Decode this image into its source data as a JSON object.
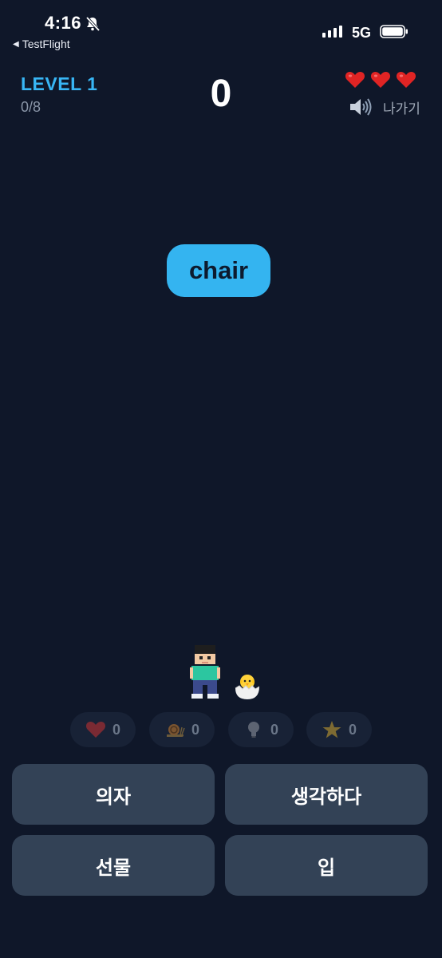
{
  "status_bar": {
    "time": "4:16",
    "back_label": "TestFlight",
    "network": "5G"
  },
  "header": {
    "level_title": "LEVEL 1",
    "progress": "0/8",
    "score": "0",
    "lives": 3,
    "exit_label": "나가기"
  },
  "word": "chair",
  "powerups": [
    {
      "name": "heart",
      "count": "0"
    },
    {
      "name": "snail",
      "count": "0"
    },
    {
      "name": "lightbulb",
      "count": "0"
    },
    {
      "name": "star",
      "count": "0"
    }
  ],
  "answers": [
    "의자",
    "생각하다",
    "선물",
    "입"
  ],
  "colors": {
    "background": "#0f1729",
    "accent": "#38b6f5",
    "bubble": "#34b4f0",
    "button": "#334256",
    "heart": "#e02424"
  }
}
